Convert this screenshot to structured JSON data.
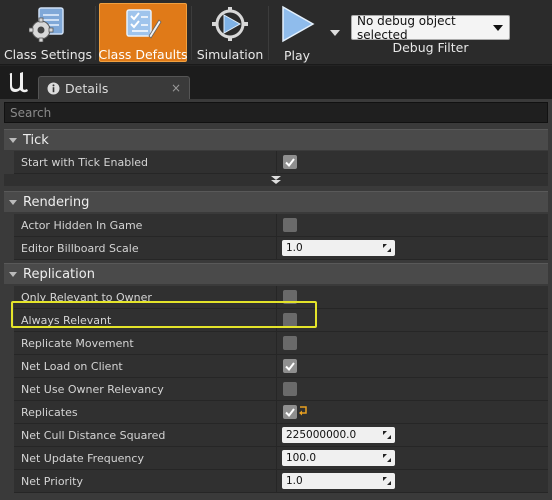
{
  "toolbar": {
    "class_settings_label": "Class Settings",
    "class_defaults_label": "Class Defaults",
    "simulation_label": "Simulation",
    "play_label": "Play",
    "debug_select_value": "No debug object selected",
    "debug_filter_label": "Debug Filter"
  },
  "tab": {
    "label": "Details",
    "close": "×"
  },
  "search": {
    "placeholder": "Search"
  },
  "categories": {
    "tick": {
      "title": "Tick",
      "rows": [
        {
          "label": "Start with Tick Enabled",
          "checked": true
        }
      ]
    },
    "rendering": {
      "title": "Rendering",
      "rows": [
        {
          "label": "Actor Hidden In Game",
          "checked": false
        },
        {
          "label": "Editor Billboard Scale",
          "value": "1.0"
        }
      ]
    },
    "replication": {
      "title": "Replication",
      "rows": [
        {
          "label": "Only Relevant to Owner",
          "checked": false
        },
        {
          "label": "Always Relevant",
          "checked": false
        },
        {
          "label": "Replicate Movement",
          "checked": false
        },
        {
          "label": "Net Load on Client",
          "checked": true
        },
        {
          "label": "Net Use Owner Relevancy",
          "checked": false
        },
        {
          "label": "Replicates",
          "checked": true
        },
        {
          "label": "Net Cull Distance Squared",
          "value": "225000000.0"
        },
        {
          "label": "Net Update Frequency",
          "value": "100.0"
        },
        {
          "label": "Net Priority",
          "value": "1.0"
        }
      ]
    }
  },
  "colors": {
    "accent": "#e07a18",
    "highlight": "#e4e42a",
    "panel": "#3a3a3a"
  }
}
